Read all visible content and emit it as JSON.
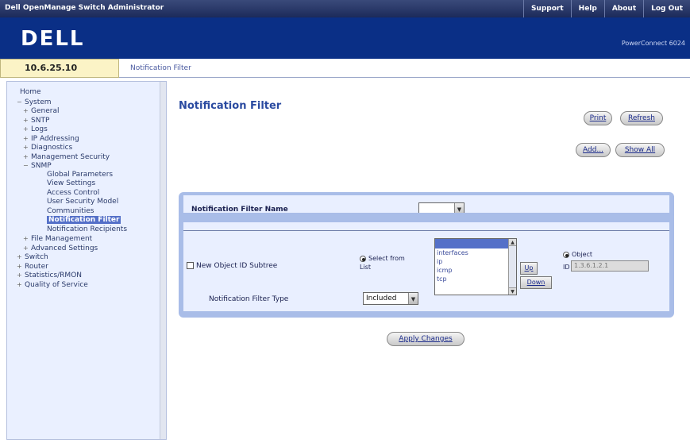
{
  "topbar": {
    "title": "Dell OpenManage Switch Administrator",
    "links": [
      "Support",
      "Help",
      "About",
      "Log Out"
    ]
  },
  "brand": {
    "logo": "DELL",
    "model": "PowerConnect 6024"
  },
  "address": {
    "ip": "10.6.25.10",
    "breadcrumb": "Notification Filter"
  },
  "tree": {
    "items": [
      {
        "label": "Home",
        "level": 0,
        "pm": ""
      },
      {
        "label": "System",
        "level": 1,
        "pm": "−"
      },
      {
        "label": "General",
        "level": 2,
        "pm": "+"
      },
      {
        "label": "SNTP",
        "level": 2,
        "pm": "+"
      },
      {
        "label": "Logs",
        "level": 2,
        "pm": "+"
      },
      {
        "label": "IP Addressing",
        "level": 2,
        "pm": "+"
      },
      {
        "label": "Diagnostics",
        "level": 2,
        "pm": "+"
      },
      {
        "label": "Management Security",
        "level": 2,
        "pm": "+"
      },
      {
        "label": "SNMP",
        "level": 2,
        "pm": "−"
      },
      {
        "label": "Global Parameters",
        "level": 3,
        "pm": ""
      },
      {
        "label": "View Settings",
        "level": 3,
        "pm": ""
      },
      {
        "label": "Access Control",
        "level": 3,
        "pm": ""
      },
      {
        "label": "User Security Model",
        "level": 3,
        "pm": ""
      },
      {
        "label": "Communities",
        "level": 3,
        "pm": ""
      },
      {
        "label": "Notification Filter",
        "level": 3,
        "pm": "",
        "selected": true
      },
      {
        "label": "Notification Recipients",
        "level": 3,
        "pm": ""
      },
      {
        "label": "File Management",
        "level": 2,
        "pm": "+"
      },
      {
        "label": "Advanced Settings",
        "level": 2,
        "pm": "+"
      },
      {
        "label": "Switch",
        "level": 1,
        "pm": "+"
      },
      {
        "label": "Router",
        "level": 1,
        "pm": "+"
      },
      {
        "label": "Statistics/RMON",
        "level": 1,
        "pm": "+"
      },
      {
        "label": "Quality of Service",
        "level": 1,
        "pm": "+"
      }
    ]
  },
  "main": {
    "title": "Notification Filter",
    "print_label": "Print",
    "refresh_label": "Refresh",
    "add_label": "Add...",
    "show_all_label": "Show All",
    "filter_name_label": "Notification Filter Name",
    "filter_name_value": "",
    "subtree_label": "New Object ID Subtree",
    "select_from_list_label": "Select from List",
    "oid_list_options": [
      "",
      "interfaces",
      "ip",
      "icmp",
      "tcp"
    ],
    "up_label": "Up",
    "down_label": "Down",
    "object_label": "Object",
    "o_label": "ID",
    "oid_value": "1.3.6.1.2.1",
    "filter_type_label": "Notification Filter Type",
    "filter_type_value": "Included",
    "apply_label": "Apply Changes"
  }
}
